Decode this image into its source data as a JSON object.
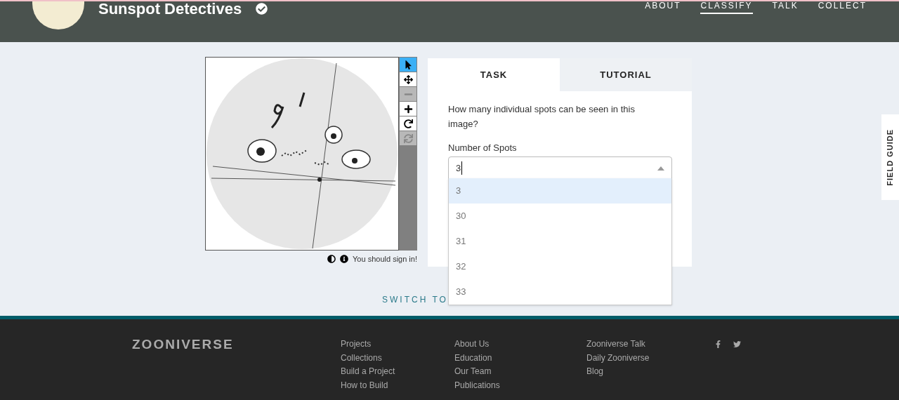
{
  "header": {
    "title": "Sunspot Detectives",
    "verified": true,
    "nav": [
      {
        "label": "ABOUT",
        "selected": false
      },
      {
        "label": "CLASSIFY",
        "selected": true
      },
      {
        "label": "TALK",
        "selected": false
      },
      {
        "label": "COLLECT",
        "selected": false
      }
    ]
  },
  "viewer": {
    "tools": [
      {
        "kind": "pointer",
        "selected": true,
        "disabled": false
      },
      {
        "kind": "move",
        "selected": false,
        "disabled": false
      },
      {
        "kind": "zoom-out",
        "selected": false,
        "disabled": true
      },
      {
        "kind": "zoom-in",
        "selected": false,
        "disabled": false
      },
      {
        "kind": "rotate",
        "selected": false,
        "disabled": false
      },
      {
        "kind": "reset",
        "selected": false,
        "disabled": true
      }
    ],
    "signin_message": "You should sign in!"
  },
  "task": {
    "tabs": [
      {
        "label": "TASK",
        "selected": true
      },
      {
        "label": "TUTORIAL",
        "selected": false
      }
    ],
    "question": "How many individual spots can be seen in this image?",
    "field_label": "Number of Spots",
    "value": "3",
    "expanded": true,
    "options": [
      {
        "label": "3",
        "selected": true
      },
      {
        "label": "30",
        "selected": false
      },
      {
        "label": "31",
        "selected": false
      },
      {
        "label": "32",
        "selected": false
      },
      {
        "label": "33",
        "selected": false
      }
    ]
  },
  "switch_link": "SWITCH TO",
  "field_guide": "FIELD GUIDE",
  "footer": {
    "logo": "ZOONIVERSE",
    "columns": [
      [
        "Projects",
        "Collections",
        "Build a Project",
        "How to Build"
      ],
      [
        "About Us",
        "Education",
        "Our Team",
        "Publications"
      ],
      [
        "Zooniverse Talk",
        "Daily Zooniverse",
        "Blog"
      ]
    ]
  }
}
